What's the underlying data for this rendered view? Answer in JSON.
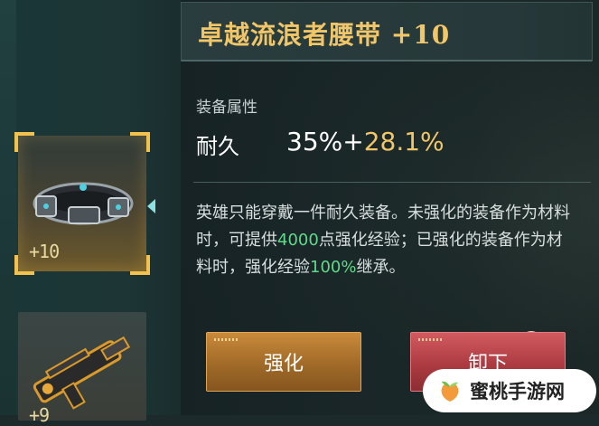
{
  "item": {
    "title": "卓越流浪者腰带 +10"
  },
  "attributes": {
    "section_label": "装备属性",
    "stat_name": "耐久",
    "stat_base": "35%",
    "stat_plus": "+",
    "stat_bonus": "28.1%"
  },
  "description": {
    "part1": "英雄只能穿戴一件耐久装备。未强化的装备作为材料时，可提供",
    "highlight1": "4000",
    "part2": "点强化经验；已强化的装备作为材料时，强化经验",
    "highlight2": "100%",
    "part3": "继承。"
  },
  "inventory": {
    "slots": [
      {
        "level": "+10",
        "icon": "belt-icon",
        "selected": true
      },
      {
        "level": "+9",
        "icon": "gun-icon",
        "selected": false
      }
    ]
  },
  "buttons": {
    "upgrade_label": "强化",
    "unequip_label": "卸下",
    "alert_mark": "!"
  },
  "watermark": {
    "text": "蜜桃手游网"
  },
  "colors": {
    "title_gold": "#f1c668",
    "bonus_gold": "#f1c668",
    "highlight_green": "#5fd98a",
    "upgrade_button": "#b07530",
    "unequip_button": "#b8434a"
  }
}
